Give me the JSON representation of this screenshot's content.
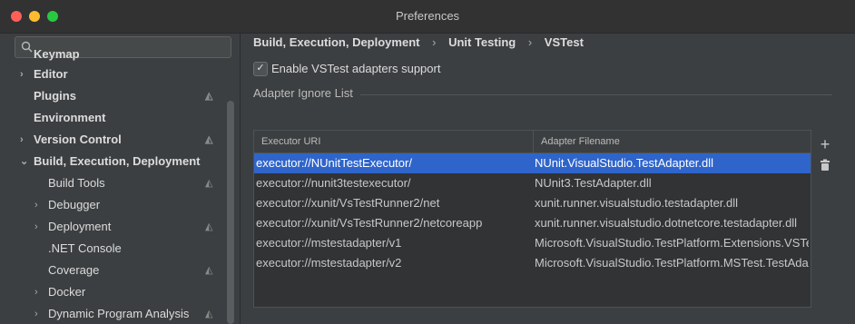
{
  "window": {
    "title": "Preferences"
  },
  "sidebar": {
    "items": [
      {
        "label": "Keymap",
        "chevron": false,
        "marker": false,
        "bold": true,
        "indent": 0
      },
      {
        "label": "Editor",
        "chevron": true,
        "marker": false,
        "bold": true,
        "indent": 0
      },
      {
        "label": "Plugins",
        "chevron": false,
        "marker": true,
        "bold": true,
        "indent": 0
      },
      {
        "label": "Environment",
        "chevron": false,
        "marker": false,
        "bold": true,
        "indent": 0
      },
      {
        "label": "Version Control",
        "chevron": true,
        "marker": true,
        "bold": true,
        "indent": 0
      },
      {
        "label": "Build, Execution, Deployment",
        "chevron": true,
        "expanded": true,
        "marker": false,
        "bold": true,
        "indent": 0
      },
      {
        "label": "Build Tools",
        "chevron": false,
        "marker": true,
        "bold": false,
        "indent": 1
      },
      {
        "label": "Debugger",
        "chevron": true,
        "marker": false,
        "bold": false,
        "indent": 1
      },
      {
        "label": "Deployment",
        "chevron": true,
        "marker": true,
        "bold": false,
        "indent": 1
      },
      {
        "label": ".NET Console",
        "chevron": false,
        "marker": false,
        "bold": false,
        "indent": 1
      },
      {
        "label": "Coverage",
        "chevron": false,
        "marker": true,
        "bold": false,
        "indent": 1
      },
      {
        "label": "Docker",
        "chevron": true,
        "marker": false,
        "bold": false,
        "indent": 1
      },
      {
        "label": "Dynamic Program Analysis",
        "chevron": true,
        "marker": true,
        "bold": false,
        "indent": 1
      }
    ]
  },
  "breadcrumb": {
    "parts": [
      "Build, Execution, Deployment",
      "Unit Testing",
      "VSTest"
    ],
    "separator": "›"
  },
  "enable_checkbox": {
    "checked": true,
    "label": "Enable VSTest adapters support"
  },
  "ignore_list": {
    "title": "Adapter Ignore List",
    "columns": [
      "Executor URI",
      "Adapter Filename"
    ],
    "rows": [
      {
        "uri": "executor://NUnitTestExecutor/",
        "file": "NUnit.VisualStudio.TestAdapter.dll",
        "selected": true
      },
      {
        "uri": "executor://nunit3testexecutor/",
        "file": "NUnit3.TestAdapter.dll",
        "selected": false
      },
      {
        "uri": "executor://xunit/VsTestRunner2/net",
        "file": "xunit.runner.visualstudio.testadapter.dll",
        "selected": false
      },
      {
        "uri": "executor://xunit/VsTestRunner2/netcoreapp",
        "file": "xunit.runner.visualstudio.dotnetcore.testadapter.dll",
        "selected": false
      },
      {
        "uri": "executor://mstestadapter/v1",
        "file": "Microsoft.VisualStudio.TestPlatform.Extensions.VSTestIntegration.dll",
        "selected": false
      },
      {
        "uri": "executor://mstestadapter/v2",
        "file": "Microsoft.VisualStudio.TestPlatform.MSTest.TestAdapter.dll",
        "selected": false
      }
    ],
    "tools": {
      "add": "+",
      "delete": "🗑"
    }
  }
}
